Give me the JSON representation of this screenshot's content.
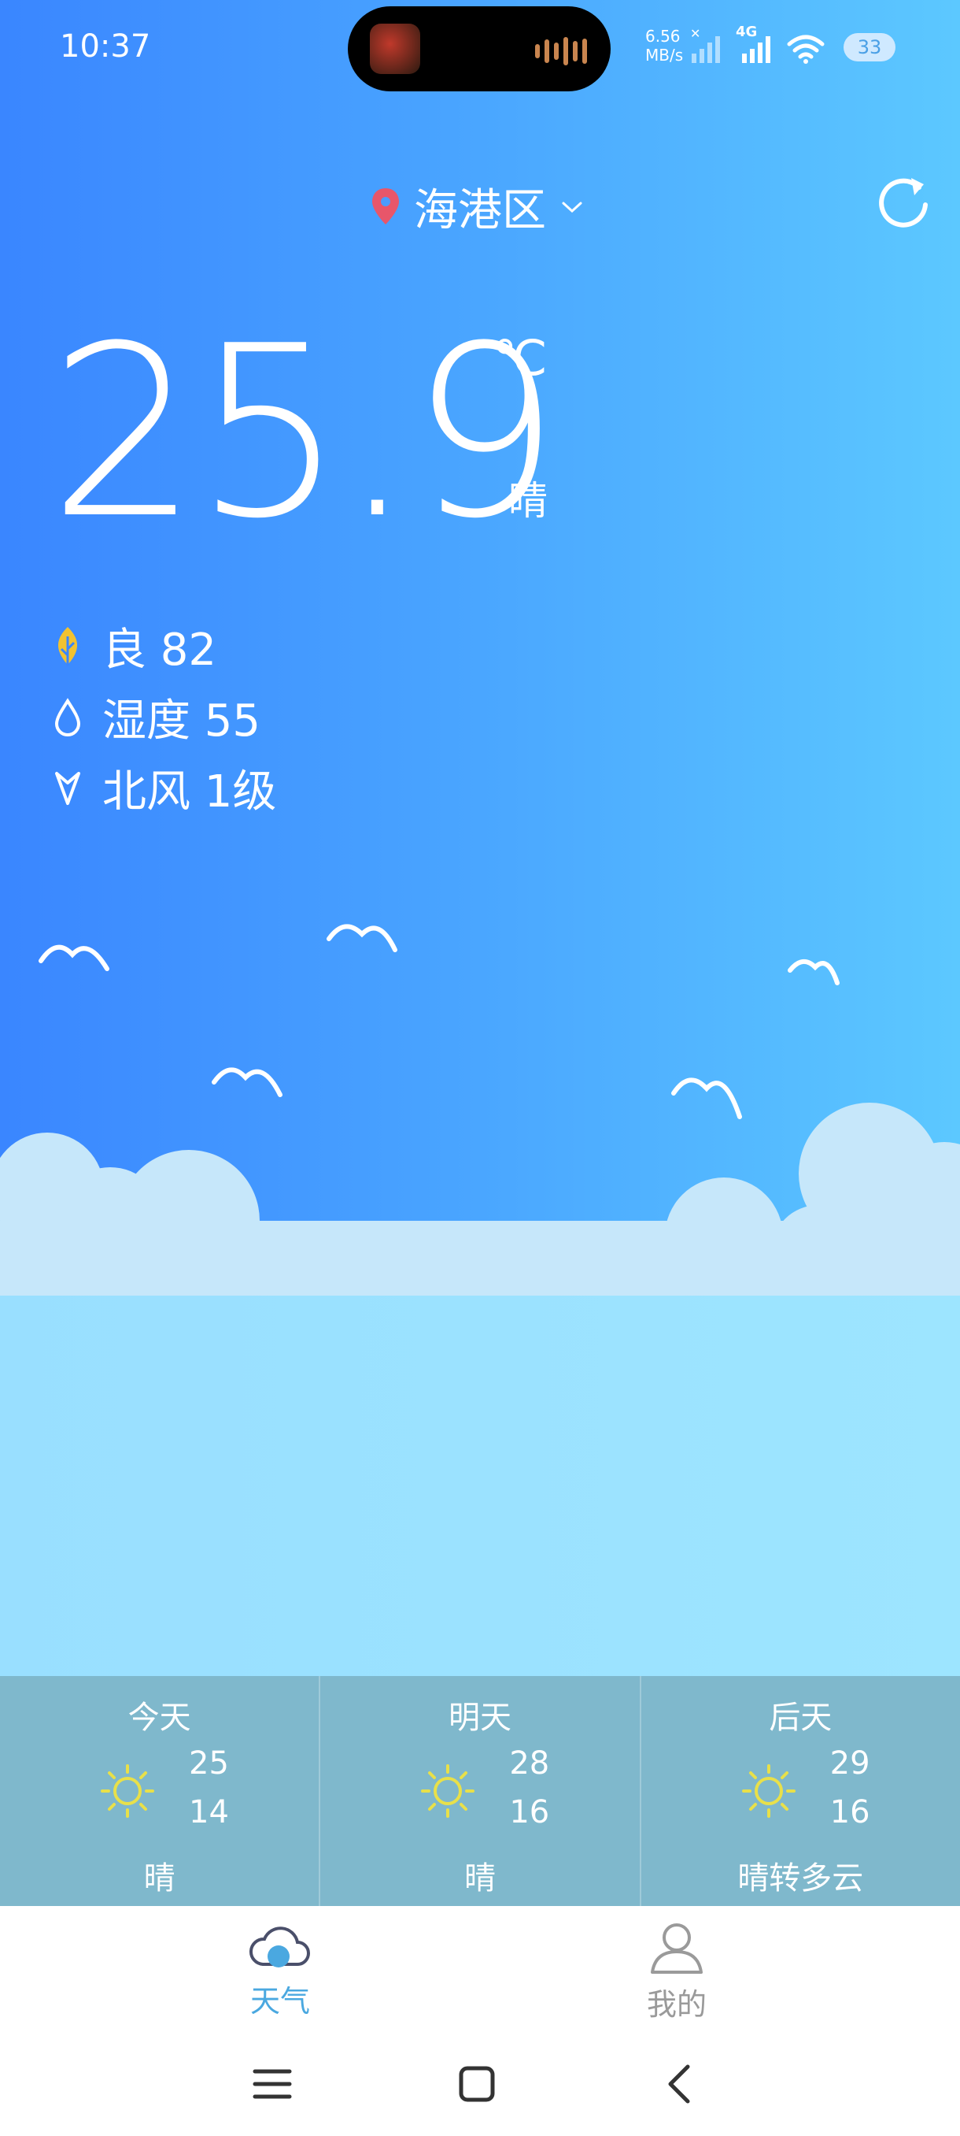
{
  "status_bar": {
    "time": "10:37",
    "net_speed_value": "6.56",
    "net_speed_unit": "MB/s",
    "network_type": "4G",
    "battery": "33"
  },
  "header": {
    "location": "海港区",
    "icons": [
      "location-pin-icon",
      "chevron-down-icon",
      "refresh-icon"
    ]
  },
  "current": {
    "temperature": "25.9",
    "unit": "℃",
    "condition": "晴"
  },
  "details": [
    {
      "icon": "leaf-icon",
      "label": "良 82"
    },
    {
      "icon": "water-drop-icon",
      "label": "湿度 55"
    },
    {
      "icon": "wind-arrow-icon",
      "label": "北风 1级"
    }
  ],
  "forecast": [
    {
      "day": "今天",
      "high": "25",
      "low": "14",
      "condition": "晴",
      "icon": "sun-icon"
    },
    {
      "day": "明天",
      "high": "28",
      "low": "16",
      "condition": "晴",
      "icon": "sun-icon"
    },
    {
      "day": "后天",
      "high": "29",
      "low": "16",
      "condition": "晴转多云",
      "icon": "sun-icon"
    }
  ],
  "tabs": [
    {
      "label": "天气",
      "icon": "weather-cloud-icon",
      "active": true
    },
    {
      "label": "我的",
      "icon": "user-icon",
      "active": false
    }
  ],
  "colors": {
    "sky_left": "#3a86ff",
    "sky_right": "#5cc8ff",
    "forecast_bar": "#7fb8cc",
    "tab_active": "#4aa8e0",
    "tab_inactive": "#9a9a9a",
    "location_pin": "#e8566a",
    "leaf": "#f2c230",
    "sun": "#e8e04a"
  }
}
